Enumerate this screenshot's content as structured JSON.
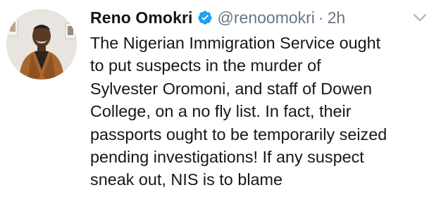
{
  "tweet": {
    "author": {
      "name": "Reno Omokri",
      "handle": "@renoomokri",
      "verified": true,
      "avatar_icon": "profile-photo"
    },
    "separator": "·",
    "timestamp": "2h",
    "menu_icon": "chevron-down-icon",
    "body_lines": [
      "The Nigerian Immigration Service ought",
      "to put suspects in the murder of",
      "Sylvester Oromoni, and staff of Dowen",
      "College, on a no fly list. In fact, their",
      "passports ought to be temporarily seized",
      "pending investigations! If any suspect",
      "sneak out, NIS is to blame"
    ]
  },
  "colors": {
    "text_primary": "#14171a",
    "text_secondary": "#657786",
    "verified_blue": "#1da1f2",
    "background": "#ffffff"
  }
}
